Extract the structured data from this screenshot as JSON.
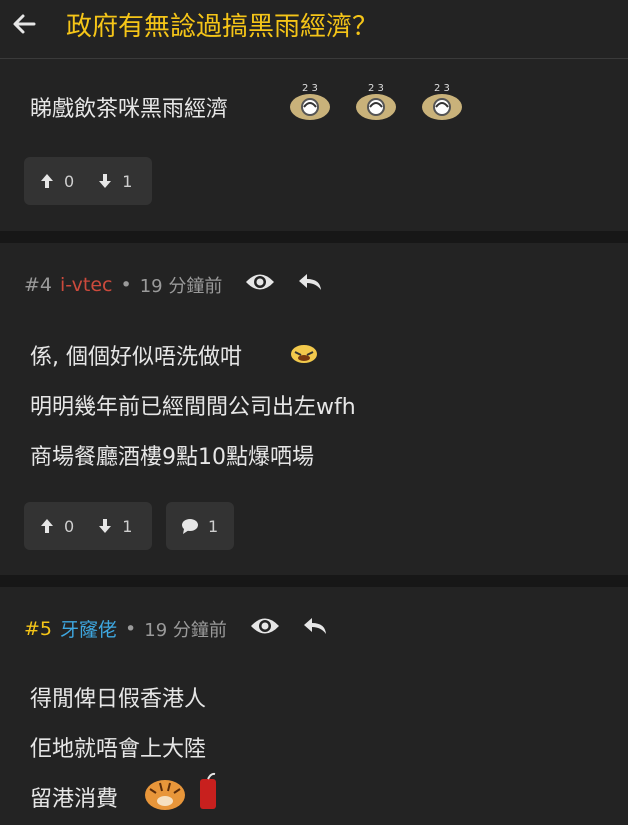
{
  "header": {
    "title": "政府有無諗過搞黑雨經濟？"
  },
  "posts": [
    {
      "lines": [
        "睇戲飲茶咪黑雨經濟"
      ],
      "upvotes": "0",
      "downvotes": "1"
    },
    {
      "number": "#4",
      "user": "i-vtec",
      "time": "19 分鐘前",
      "lines": [
        "係, 個個好似唔洗做咁",
        "明明幾年前已經間間公司出左wfh",
        "商場餐廳酒樓9點10點爆哂場"
      ],
      "upvotes": "0",
      "downvotes": "1",
      "replies": "1"
    },
    {
      "number": "#5",
      "user": "牙窿佬",
      "time": "19 分鐘前",
      "lines": [
        "得閒俾日假香港人",
        "佢地就唔會上大陸",
        "留港消費"
      ]
    }
  ],
  "colors": {
    "accent": "#f5c518",
    "user4": "#cc4a3c",
    "user5": "#3ea7e0"
  }
}
